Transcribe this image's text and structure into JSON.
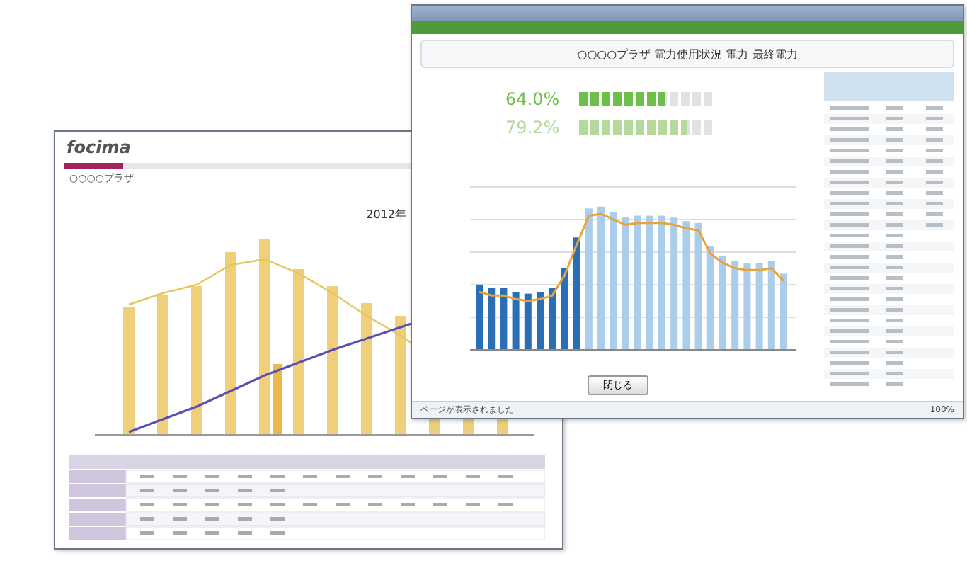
{
  "back_window": {
    "logo": "focima",
    "site_name": "○○○○プラザ",
    "year": "2012年"
  },
  "front_window": {
    "title": "○○○○プラザ 電力使用状況 電力 最終電力",
    "ratios": [
      {
        "value": "64.0%",
        "level": 0.64,
        "color": "#6cc04a"
      },
      {
        "value": "79.2%",
        "level": 0.79,
        "color": "#b5d99a"
      }
    ],
    "close_button": "閉じる",
    "status": "ページが表示されました",
    "zoom": "100%"
  }
}
